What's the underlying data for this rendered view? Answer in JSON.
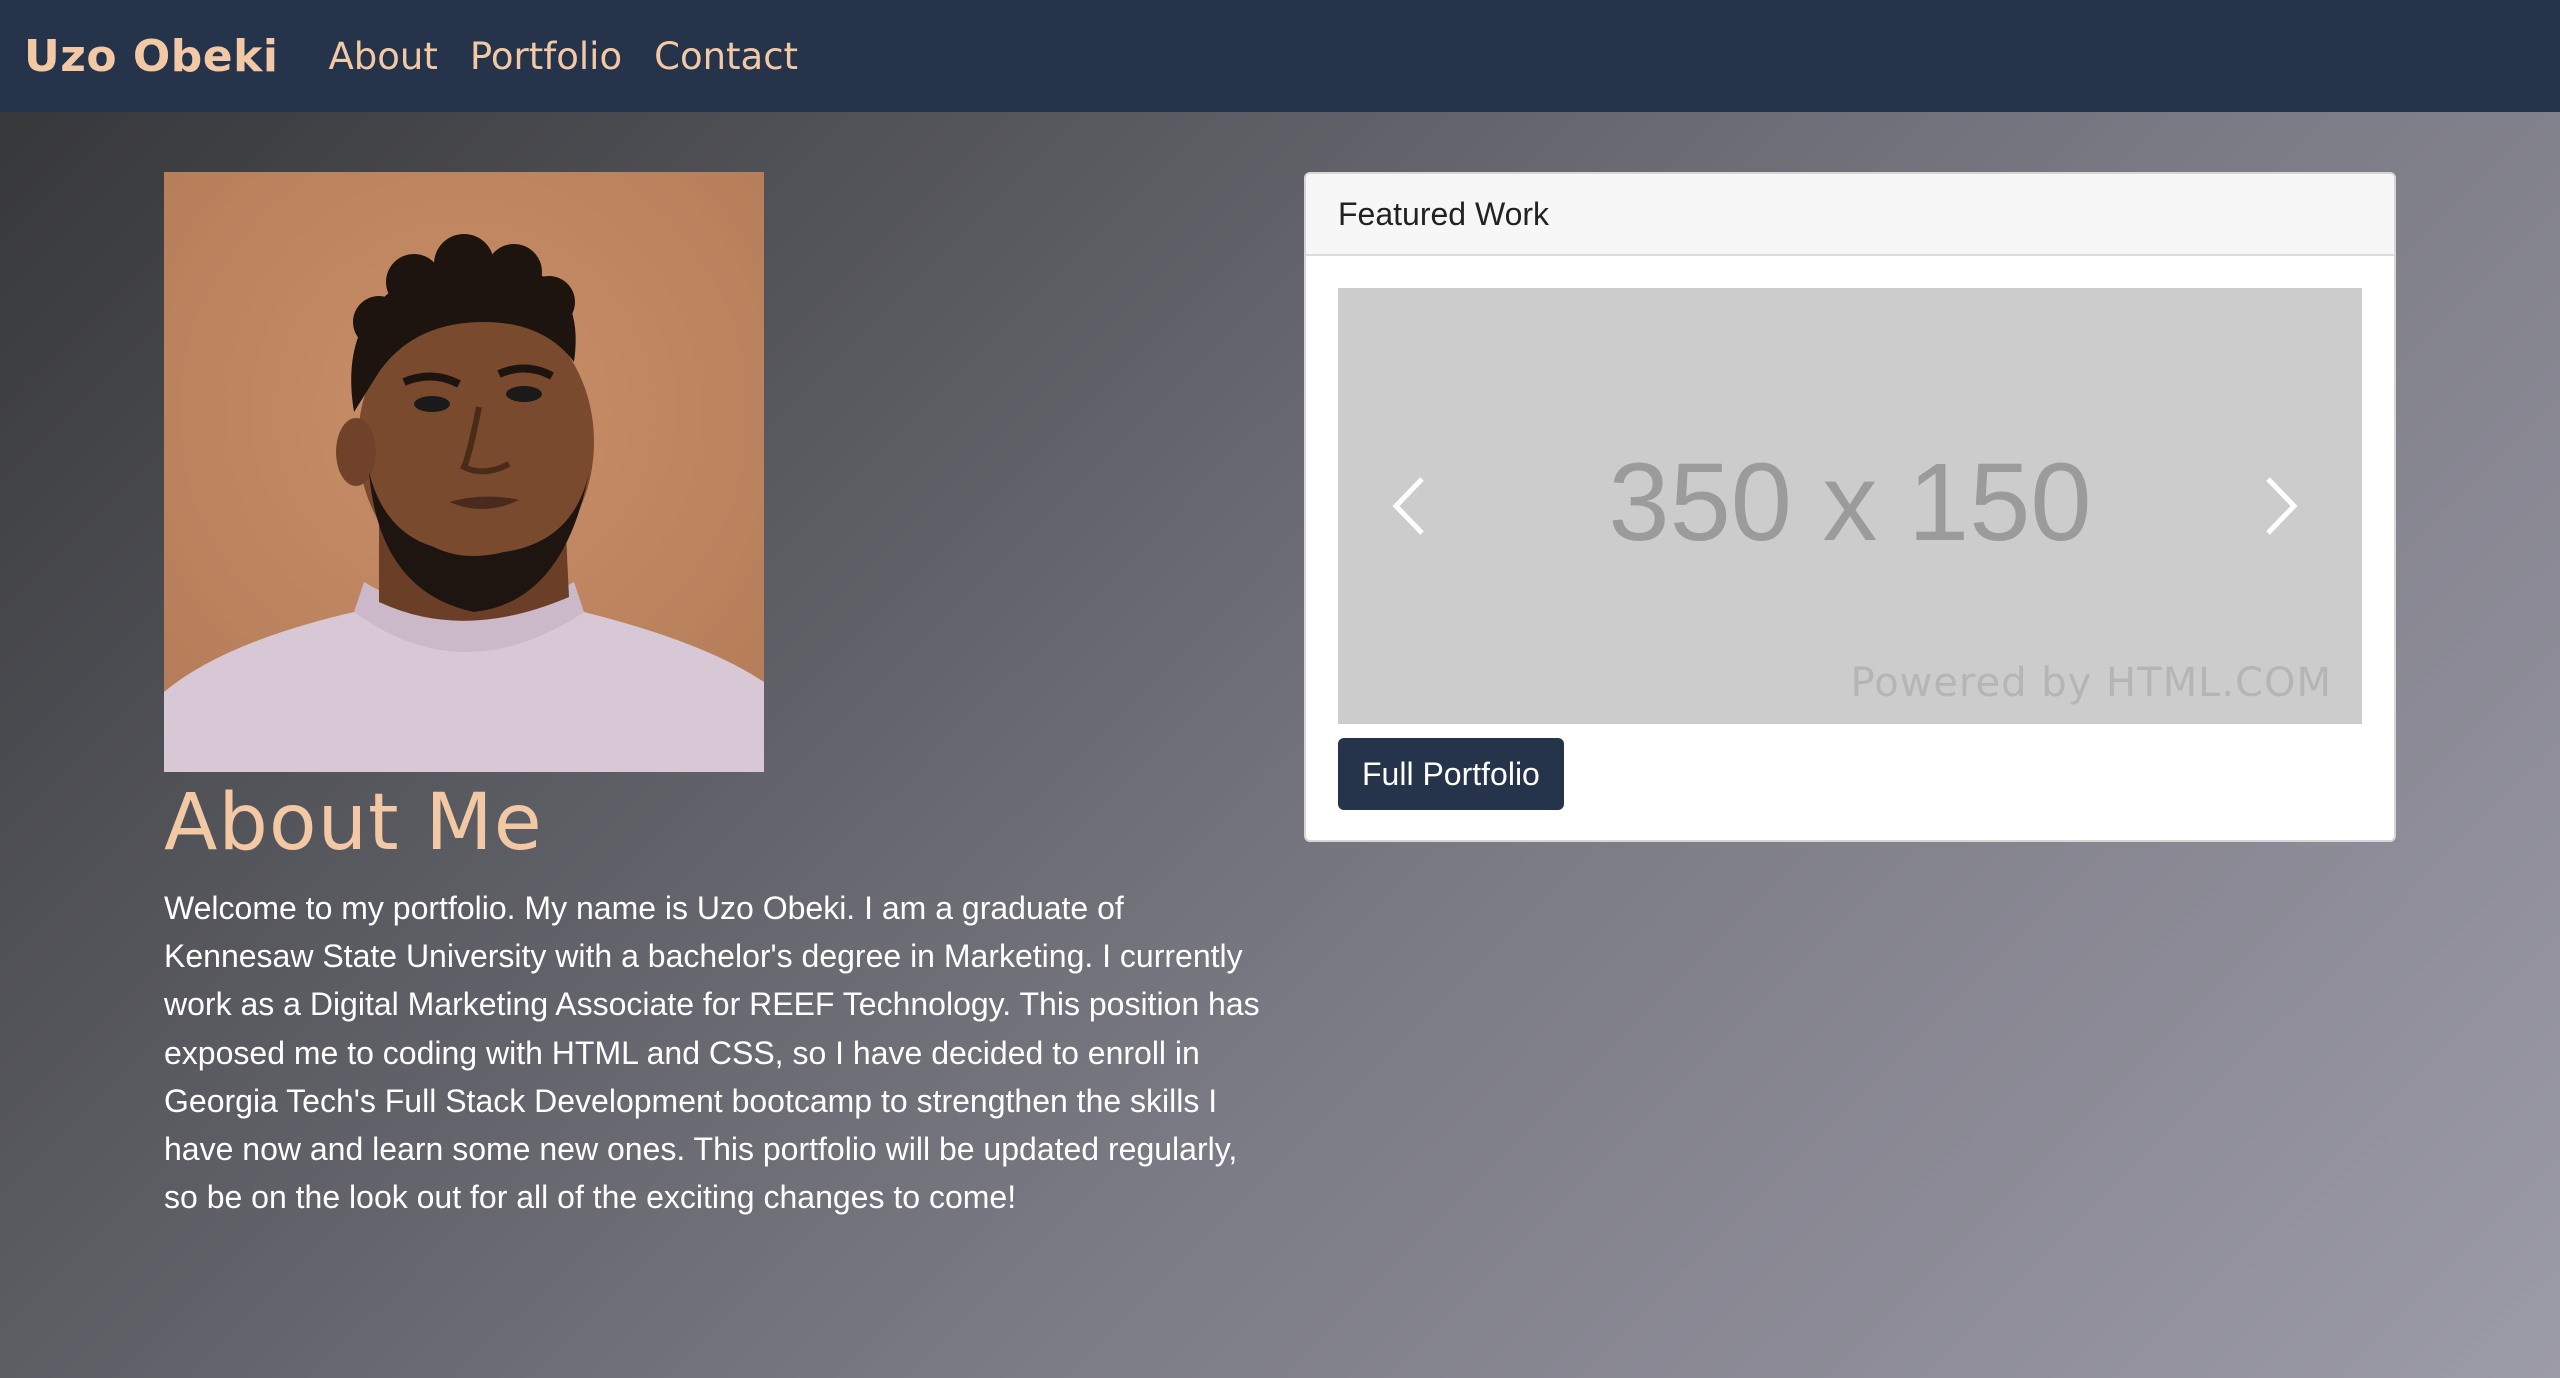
{
  "navbar": {
    "brand": "Uzo Obeki",
    "links": [
      {
        "label": "About"
      },
      {
        "label": "Portfolio"
      },
      {
        "label": "Contact"
      }
    ]
  },
  "about": {
    "heading": "About Me",
    "text": "Welcome to my portfolio. My name is Uzo Obeki. I am a graduate of Kennesaw State University with a bachelor's degree in Marketing. I currently work as a Digital Marketing Associate for REEF Technology. This position has exposed me to coding with HTML and CSS, so I have decided to enroll in Georgia Tech's Full Stack Development bootcamp to strengthen the skills I have now and learn some new ones. This portfolio will be updated regularly, so be on the look out for all of the exciting changes to come!"
  },
  "featured": {
    "header": "Featured Work",
    "placeholder_text": "350 x 150",
    "powered_by": "Powered by HTML.COM",
    "button_label": "Full Portfolio",
    "prev_icon": "chevron-left-icon",
    "next_icon": "chevron-right-icon"
  },
  "colors": {
    "navbar": "#25344b",
    "accent": "#f3c8a4",
    "button": "#25344b"
  }
}
